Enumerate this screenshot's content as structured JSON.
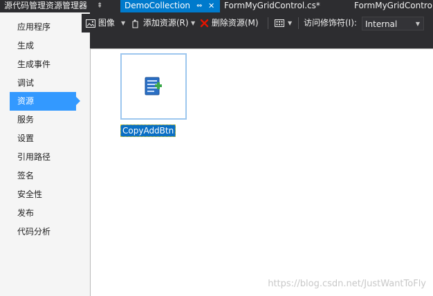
{
  "tabs": {
    "explorer": {
      "label": "源代码管理资源管理器",
      "pin": "⇞"
    },
    "active": {
      "label": "DemoCollection",
      "pin": "⇔",
      "close": "✕"
    },
    "cs": {
      "label": "FormMyGridControl.cs*"
    },
    "form": {
      "label": "FormMyGridControl"
    }
  },
  "sidebar": {
    "items": [
      {
        "label": "应用程序"
      },
      {
        "label": "生成"
      },
      {
        "label": "生成事件"
      },
      {
        "label": "调试"
      },
      {
        "label": "资源",
        "active": true
      },
      {
        "label": "服务"
      },
      {
        "label": "设置"
      },
      {
        "label": "引用路径"
      },
      {
        "label": "签名"
      },
      {
        "label": "安全性"
      },
      {
        "label": "发布"
      },
      {
        "label": "代码分析"
      }
    ]
  },
  "toolbar": {
    "image_label": "图像",
    "add_resource_label": "添加资源(R)",
    "remove_resource_label": "删除资源(M)",
    "access_modifier_label": "访问修饰符(I):",
    "access_modifier_value": "Internal",
    "dropdown_glyph": "▼"
  },
  "content": {
    "resource_name": "CopyAddBtn",
    "watermark": "https://blog.csdn.net/JustWantToFly"
  },
  "icons": {
    "image": "image-icon",
    "add": "add-resource-icon",
    "remove": "remove-resource-icon",
    "view": "view-grid-icon",
    "resource": "document-add-icon"
  },
  "colors": {
    "accent": "#007acc",
    "selection": "#3399ff",
    "remove_icon": "#e51400"
  }
}
